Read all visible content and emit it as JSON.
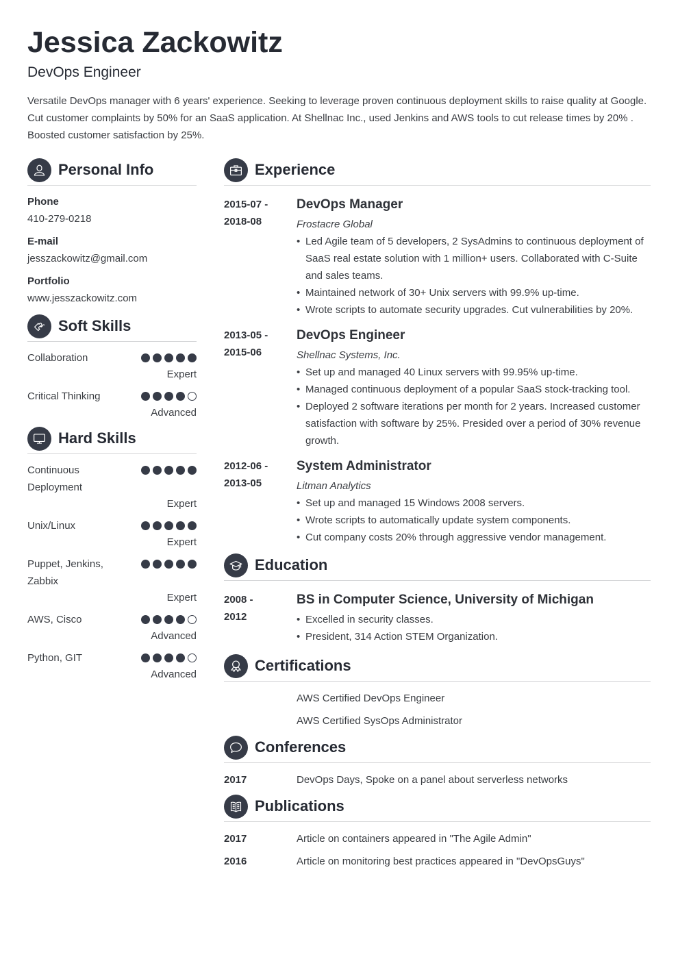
{
  "header": {
    "name": "Jessica Zackowitz",
    "title": "DevOps Engineer",
    "summary": "Versatile DevOps manager with 6 years' experience. Seeking to leverage proven continuous deployment skills to raise quality at Google. Cut customer complaints by 50% for an SaaS application. At Shellnac Inc., used Jenkins and AWS tools to cut release times by 20% . Boosted customer satisfaction by 25%."
  },
  "colors": {
    "accent": "#363b47",
    "text": "#3a3d42",
    "divider": "#d4d5d7"
  },
  "personal_info": {
    "heading": "Personal Info",
    "icon": "person-icon",
    "fields": [
      {
        "label": "Phone",
        "value": "410-279-0218"
      },
      {
        "label": "E-mail",
        "value": "jesszackowitz@gmail.com"
      },
      {
        "label": "Portfolio",
        "value": "www.jesszackowitz.com"
      }
    ]
  },
  "soft_skills": {
    "heading": "Soft Skills",
    "icon": "puzzle-icon",
    "items": [
      {
        "name": "Collaboration",
        "rating": 5,
        "max": 5,
        "level": "Expert"
      },
      {
        "name": "Critical Thinking",
        "rating": 4,
        "max": 5,
        "level": "Advanced"
      }
    ]
  },
  "hard_skills": {
    "heading": "Hard Skills",
    "icon": "monitor-icon",
    "items": [
      {
        "name": "Continuous Deployment",
        "rating": 5,
        "max": 5,
        "level": "Expert"
      },
      {
        "name": "Unix/Linux",
        "rating": 5,
        "max": 5,
        "level": "Expert"
      },
      {
        "name": "Puppet, Jenkins, Zabbix",
        "rating": 5,
        "max": 5,
        "level": "Expert"
      },
      {
        "name": "AWS, Cisco",
        "rating": 4,
        "max": 5,
        "level": "Advanced"
      },
      {
        "name": "Python, GIT",
        "rating": 4,
        "max": 5,
        "level": "Advanced"
      }
    ]
  },
  "experience": {
    "heading": "Experience",
    "icon": "briefcase-icon",
    "items": [
      {
        "date_start": "2015-07 -",
        "date_end": "2018-08",
        "title": "DevOps Manager",
        "company": "Frostacre Global",
        "bullets": [
          "Led Agile team of 5 developers, 2 SysAdmins to continuous deployment of SaaS real estate solution with 1 million+ users. Collaborated with C-Suite and sales teams.",
          "Maintained network of 30+ Unix servers with 99.9% up-time.",
          "Wrote scripts to automate security upgrades. Cut vulnerabilities by 20%."
        ]
      },
      {
        "date_start": "2013-05 -",
        "date_end": "2015-06",
        "title": "DevOps Engineer",
        "company": "Shellnac Systems, Inc.",
        "bullets": [
          "Set up and managed 40 Linux servers with 99.95% up-time.",
          "Managed continuous deployment of a popular SaaS stock-tracking tool.",
          "Deployed 2 software iterations per month for 2 years. Increased customer satisfaction with software by 25%. Presided over a period of 30% revenue growth."
        ]
      },
      {
        "date_start": "2012-06 -",
        "date_end": "2013-05",
        "title": "System Administrator",
        "company": "Litman Analytics",
        "bullets": [
          "Set up and managed 15 Windows 2008 servers.",
          "Wrote scripts to automatically update system components.",
          "Cut company costs 20% through aggressive vendor management."
        ]
      }
    ]
  },
  "education": {
    "heading": "Education",
    "icon": "graduation-cap-icon",
    "items": [
      {
        "date_start": "2008 -",
        "date_end": "2012",
        "title": "BS in Computer Science, University of Michigan",
        "bullets": [
          "Excelled in security classes.",
          "President, 314 Action STEM Organization."
        ]
      }
    ]
  },
  "certifications": {
    "heading": "Certifications",
    "icon": "award-ribbon-icon",
    "items": [
      "AWS Certified DevOps Engineer",
      "AWS Certified SysOps Administrator"
    ]
  },
  "conferences": {
    "heading": "Conferences",
    "icon": "speech-bubble-icon",
    "items": [
      {
        "year": "2017",
        "text": "DevOps Days, Spoke on a panel about serverless networks"
      }
    ]
  },
  "publications": {
    "heading": "Publications",
    "icon": "open-book-icon",
    "items": [
      {
        "year": "2017",
        "text": "Article on containers appeared in \"The Agile Admin\""
      },
      {
        "year": "2016",
        "text": "Article on monitoring best practices appeared in \"DevOpsGuys\""
      }
    ]
  }
}
